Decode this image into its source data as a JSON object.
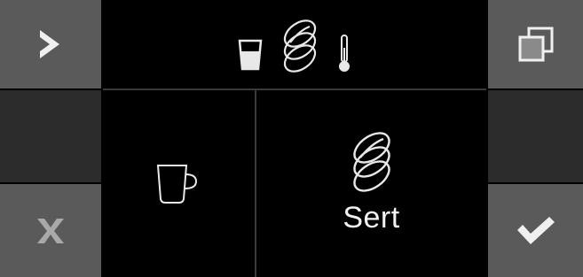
{
  "left_column": {
    "top_button": {
      "icon": "chevron-right-icon"
    },
    "bottom_button": {
      "icon": "close-x-icon"
    }
  },
  "right_column": {
    "top_button": {
      "icon": "copy-icon"
    },
    "bottom_button": {
      "icon": "checkmark-icon"
    }
  },
  "top_panel": {
    "icons": [
      "glass-icon",
      "coffee-beans-icon",
      "thermometer-icon"
    ]
  },
  "cup_panel": {
    "icon": "cup-icon"
  },
  "strength_panel": {
    "icon": "coffee-beans-icon",
    "label": "Sert"
  },
  "colors": {
    "side_button": "#5a5a5a",
    "side_blank": "#2c2c2c",
    "background": "#000000",
    "icon_light": "#e8e8e8"
  }
}
